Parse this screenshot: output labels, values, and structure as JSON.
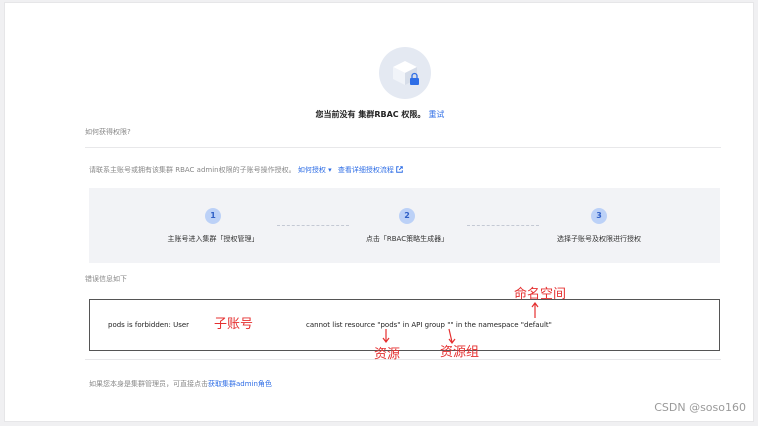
{
  "header": {
    "title": "您当前没有 集群RBAC 权限。",
    "retry_label": "重试"
  },
  "section_how": {
    "label": "如何获得权限?"
  },
  "instructions": {
    "text": "请联系主账号或拥有该集群 RBAC admin权限的子账号操作授权。",
    "how_link": "如何授权",
    "detail_link": "查看详细授权流程"
  },
  "steps": [
    {
      "number": "1",
      "label": "主账号进入集群「授权管理」"
    },
    {
      "number": "2",
      "label": "点击「RBAC策略生成器」"
    },
    {
      "number": "3",
      "label": "选择子账号及权限进行授权"
    }
  ],
  "error_section": {
    "label": "错误信息如下",
    "prefix": "pods is forbidden: User",
    "suffix": "cannot list resource \"pods\" in API group \"\" in the namespace \"default\""
  },
  "annotations": {
    "sub_account": "子账号",
    "resource": "资源",
    "resource_group": "资源组",
    "namespace": "命名空间",
    "color": "#e53030"
  },
  "footer": {
    "text": "如果您本身是集群管理员，可直接点击",
    "link": "获取集群admin角色"
  },
  "watermark": "CSDN @soso160",
  "colors": {
    "accent": "#2f6ee6",
    "step_circle": "#bcd1f7",
    "steps_bg": "#f2f3f6"
  }
}
